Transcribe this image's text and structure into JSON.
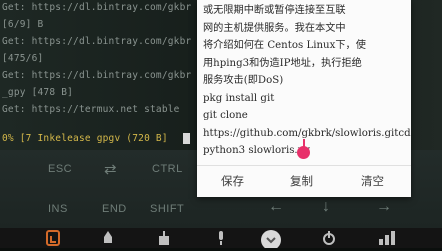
{
  "terminal": {
    "lines": [
      "Get:  https://dl.bintray.com/gkbr",
      "[6/9] B",
      "Get:  https://dl.bintray.com/gkbr",
      "[475/6]",
      "Get:  https://dl.bintray.com/gkbr",
      "_gpy [478 B]",
      "Get:  https://termux.net stable",
      "0% [7 Inkelease gpgv (720 B]"
    ]
  },
  "popup": {
    "text": "或无限期中断或暂停连接至互联\n网的主机提供服务。我在本文中\n将介绍如何在 Centos Linux下，使\n用hping3和伪造IP地址，执行拒绝\n服务攻击(即DoS)\npkg install git\ngit clone\nhttps://github.com/gkbrk/slowloris.gitcd\npython3 slowloris.py",
    "save": "保存",
    "copy": "复制",
    "clear": "清空"
  },
  "keys": {
    "row1": [
      "ESC",
      "⇄",
      "CTRL"
    ],
    "row2": [
      "INS",
      "END",
      "SHIFT"
    ],
    "arrows": [
      "←",
      "↓",
      "→"
    ]
  },
  "nav": {
    "icons": [
      "file-icon",
      "rocket-icon",
      "download-icon",
      "mic-icon",
      "keyboard-icon",
      "power-icon",
      "signal-icon"
    ]
  }
}
